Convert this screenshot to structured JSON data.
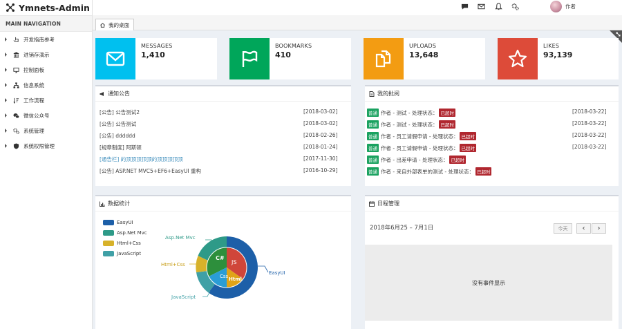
{
  "app": {
    "title": "Ymnets-Admin"
  },
  "sidebar": {
    "header": "MAIN NAVIGATION",
    "items": [
      {
        "label": "开发指南参考",
        "icon": "hand-pointer-icon"
      },
      {
        "label": "进销存演示",
        "icon": "bank-icon"
      },
      {
        "label": "控制面板",
        "icon": "desktop-icon"
      },
      {
        "label": "信息系统",
        "icon": "sitemap-icon"
      },
      {
        "label": "工作流程",
        "icon": "sort-icon"
      },
      {
        "label": "微信公众号",
        "icon": "wechat-icon"
      },
      {
        "label": "系统管理",
        "icon": "gears-icon"
      },
      {
        "label": "系统权限管理",
        "icon": "shield-icon"
      }
    ]
  },
  "topbar": {
    "user_name": "作者"
  },
  "tabs": {
    "active": "我的桌面"
  },
  "stats": [
    {
      "label": "MESSAGES",
      "value": "1,410",
      "color": "#00c0ef",
      "icon": "envelope-icon"
    },
    {
      "label": "BOOKMARKS",
      "value": "410",
      "color": "#00a65a",
      "icon": "flag-icon"
    },
    {
      "label": "UPLOADS",
      "value": "13,648",
      "color": "#f39c12",
      "icon": "files-icon"
    },
    {
      "label": "LIKES",
      "value": "93,139",
      "color": "#dd4b39",
      "icon": "star-icon"
    }
  ],
  "notices": {
    "title": "通知公告",
    "rows": [
      {
        "text": "[公告] 公告测试2",
        "date": "[2018-03-02]"
      },
      {
        "text": "[公告] 公告测试",
        "date": "[2018-03-02]"
      },
      {
        "text": "[公告] dddddd",
        "date": "[2018-02-26]"
      },
      {
        "text": "[规章制度] 阿斯顿",
        "date": "[2018-01-24]"
      },
      {
        "text": "[通告栏] 的顶顶顶顶顶的顶顶顶顶顶",
        "date": "[2017-11-30]"
      },
      {
        "text": "[公告] ASP.NET MVC5+EF6+EasyUI 重构",
        "date": "[2016-10-29]"
      }
    ]
  },
  "approvals": {
    "title": "我的批阅",
    "rows": [
      {
        "badge": "普通",
        "text": "作者 - 测试 - 处理状态：",
        "status": "已超时",
        "date": "[2018-03-22]"
      },
      {
        "badge": "普通",
        "text": "作者 - 测试 - 处理状态：",
        "status": "已超时",
        "date": "[2018-03-22]"
      },
      {
        "badge": "普通",
        "text": "作者 - 员工请假申请 - 处理状态：",
        "status": "已超时",
        "date": "[2018-03-22]"
      },
      {
        "badge": "普通",
        "text": "作者 - 员工请假申请 - 处理状态：",
        "status": "已超时",
        "date": "[2018-03-22]"
      },
      {
        "badge": "普通",
        "text": "作者 - 出差申请 - 处理状态：",
        "status": "已超时",
        "date": ""
      },
      {
        "badge": "普通",
        "text": "作者 - 来自外部表单的测试 - 处理状态：",
        "status": "已超时",
        "date": ""
      }
    ]
  },
  "stats_panel": {
    "title": "数据统计"
  },
  "chart_data": {
    "type": "pie",
    "series": [
      {
        "name": "EasyUI",
        "color": "#1d5fa8"
      },
      {
        "name": "Asp.Net Mvc",
        "color": "#2e9a88"
      },
      {
        "name": "Html+Css",
        "color": "#d7b22a"
      },
      {
        "name": "JavaScript",
        "color": "#3fa0a6"
      }
    ],
    "inner": [
      {
        "label": "JS",
        "color": "#d0463a"
      },
      {
        "label": "C#",
        "color": "#2d8f3c"
      },
      {
        "label": "Css",
        "color": "#2a9dd6"
      },
      {
        "label": "Html",
        "color": "#e0a418"
      }
    ],
    "legend": "top-left"
  },
  "calendar": {
    "title": "日程管理",
    "range": "2018年6月25 – 7月1日",
    "today": "今天",
    "prev": "‹",
    "next": "›",
    "empty": "没有事件显示"
  }
}
